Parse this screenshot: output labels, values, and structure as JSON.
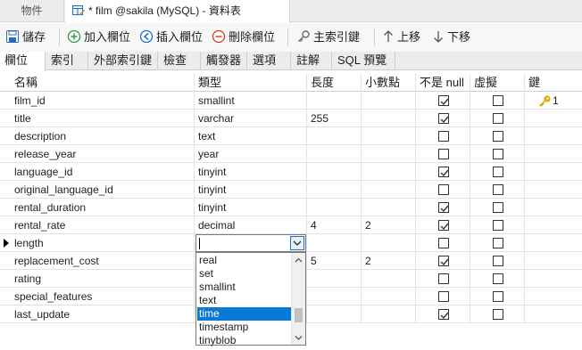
{
  "doc_tabs": [
    {
      "label": "物件"
    },
    {
      "label": "* film @sakila (MySQL) - 資料表"
    }
  ],
  "toolbar": {
    "save": "儲存",
    "add_field": "加入欄位",
    "insert_field": "插入欄位",
    "delete_field": "刪除欄位",
    "primary_key": "主索引鍵",
    "move_up": "上移",
    "move_down": "下移"
  },
  "sub_tabs": [
    "欄位",
    "索引",
    "外部索引鍵",
    "檢查",
    "觸發器",
    "選項",
    "註解",
    "SQL 預覽"
  ],
  "columns": {
    "name": "名稱",
    "type": "類型",
    "length": "長度",
    "decimals": "小數點",
    "not_null": "不是 null",
    "virtual": "虛擬",
    "key": "鍵"
  },
  "rows": [
    {
      "name": "film_id",
      "type": "smallint",
      "length": "",
      "decimals": "",
      "not_null": true,
      "virtual": false,
      "key": "1"
    },
    {
      "name": "title",
      "type": "varchar",
      "length": "255",
      "decimals": "",
      "not_null": true,
      "virtual": false,
      "key": ""
    },
    {
      "name": "description",
      "type": "text",
      "length": "",
      "decimals": "",
      "not_null": false,
      "virtual": false,
      "key": ""
    },
    {
      "name": "release_year",
      "type": "year",
      "length": "",
      "decimals": "",
      "not_null": false,
      "virtual": false,
      "key": ""
    },
    {
      "name": "language_id",
      "type": "tinyint",
      "length": "",
      "decimals": "",
      "not_null": true,
      "virtual": false,
      "key": ""
    },
    {
      "name": "original_language_id",
      "type": "tinyint",
      "length": "",
      "decimals": "",
      "not_null": false,
      "virtual": false,
      "key": ""
    },
    {
      "name": "rental_duration",
      "type": "tinyint",
      "length": "",
      "decimals": "",
      "not_null": true,
      "virtual": false,
      "key": ""
    },
    {
      "name": "rental_rate",
      "type": "decimal",
      "length": "4",
      "decimals": "2",
      "not_null": true,
      "virtual": false,
      "key": ""
    },
    {
      "name": "length",
      "type": "",
      "length": "",
      "decimals": "",
      "not_null": false,
      "virtual": false,
      "key": "",
      "editing": true
    },
    {
      "name": "replacement_cost",
      "type": "",
      "length": "5",
      "decimals": "2",
      "not_null": true,
      "virtual": false,
      "key": ""
    },
    {
      "name": "rating",
      "type": "",
      "length": "",
      "decimals": "",
      "not_null": false,
      "virtual": false,
      "key": ""
    },
    {
      "name": "special_features",
      "type": "",
      "length": "",
      "decimals": "",
      "not_null": false,
      "virtual": false,
      "key": ""
    },
    {
      "name": "last_update",
      "type": "",
      "length": "",
      "decimals": "",
      "not_null": true,
      "virtual": false,
      "key": ""
    }
  ],
  "type_dropdown": {
    "value": "",
    "options": [
      "real",
      "set",
      "smallint",
      "text",
      "time",
      "timestamp",
      "tinyblob"
    ],
    "highlighted": "time"
  },
  "colors": {
    "selection": "#0a78d7",
    "key_icon": "#e0a800",
    "add_icon": "#2e9a3c",
    "insert_icon": "#1f6fc9",
    "delete_icon": "#d23a2a"
  }
}
